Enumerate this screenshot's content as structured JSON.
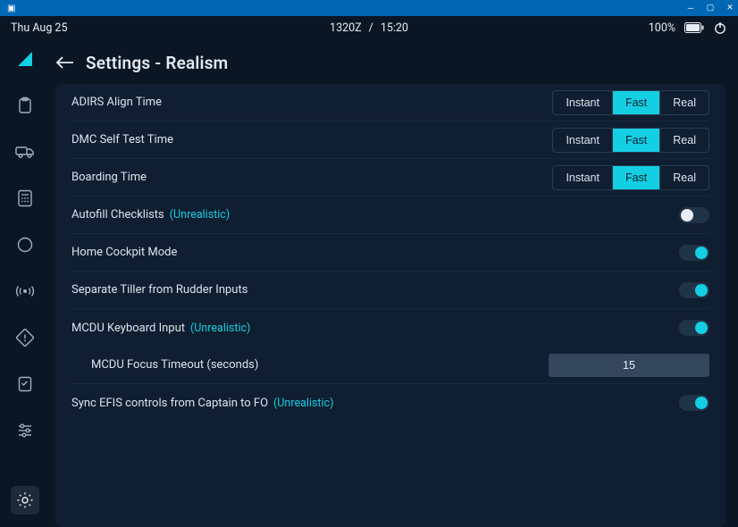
{
  "status": {
    "date": "Thu Aug 25",
    "zulu": "1320Z",
    "sep": "/",
    "local": "15:20",
    "battery_pct": "100%"
  },
  "page": {
    "title": "Settings - Realism"
  },
  "options": {
    "instant": "Instant",
    "fast": "Fast",
    "real": "Real"
  },
  "rows": {
    "adirs": {
      "label": "ADIRS Align Time",
      "value": "Fast"
    },
    "dmc": {
      "label": "DMC Self Test Time",
      "value": "Fast"
    },
    "boarding": {
      "label": "Boarding Time",
      "value": "Fast"
    },
    "autofill": {
      "label": "Autofill Checklists",
      "tag": "(Unrealistic)",
      "on": false
    },
    "homecockpit": {
      "label": "Home Cockpit Mode",
      "on": true
    },
    "tiller": {
      "label": "Separate Tiller from Rudder Inputs",
      "on": true
    },
    "mcdu": {
      "label": "MCDU Keyboard Input",
      "tag": "(Unrealistic)",
      "on": true
    },
    "mcdu_timeout": {
      "label": "MCDU Focus Timeout (seconds)",
      "value": "15"
    },
    "efis": {
      "label": "Sync EFIS controls from Captain to FO",
      "tag": "(Unrealistic)",
      "on": true
    }
  }
}
